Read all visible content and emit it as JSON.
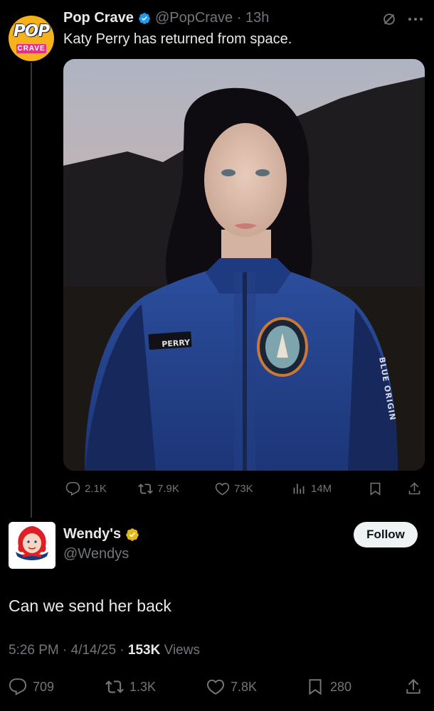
{
  "original_tweet": {
    "avatar": {
      "line1": "POP",
      "line2": "CRAVE"
    },
    "display_name": "Pop Crave",
    "handle_time": "@PopCrave · 13h",
    "text": "Katy Perry has returned from space.",
    "media": {
      "name_patch": "PERRY",
      "sleeve_text": "BLUE ORIGIN"
    },
    "actions": {
      "replies": "2.1K",
      "reposts": "7.9K",
      "likes": "73K",
      "views": "14M"
    }
  },
  "reply_tweet": {
    "display_name": "Wendy's",
    "handle": "@Wendys",
    "follow_label": "Follow",
    "text": "Can we send her back",
    "meta": {
      "time_date": "5:26 PM · 4/14/25 · ",
      "views_count": "153K",
      "views_label": " Views"
    },
    "actions": {
      "replies": "709",
      "reposts": "1.3K",
      "likes": "7.8K",
      "bookmarks": "280"
    }
  },
  "colors": {
    "background": "#000000",
    "text": "#e7e9ea",
    "muted": "#71767b",
    "verified_blue": "#1d9bf0",
    "verified_gold": "#e2b719"
  }
}
